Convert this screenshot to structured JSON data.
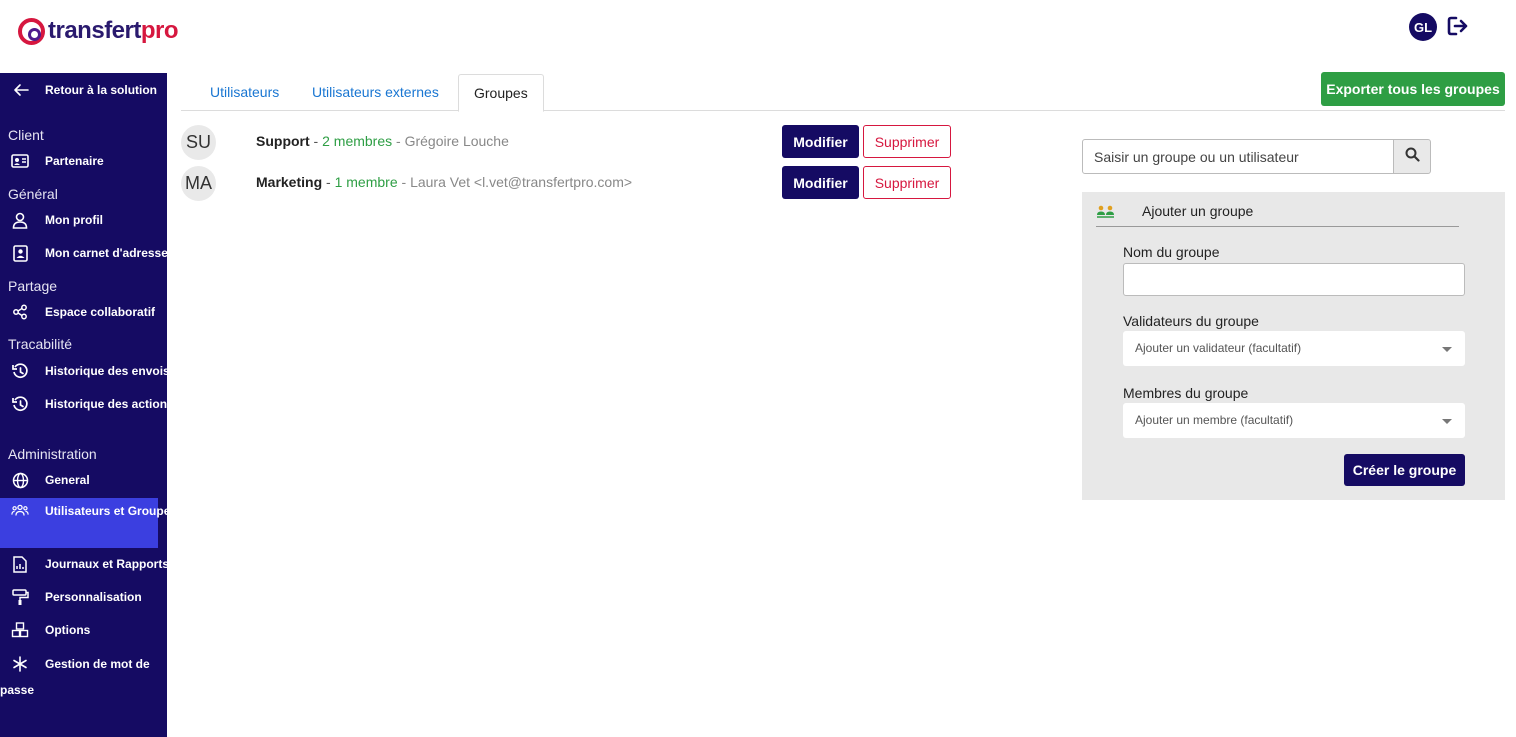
{
  "header": {
    "logo_main": "transfert",
    "logo_accent": "pro",
    "user_initials": "GL",
    "logout_icon": "logout-icon"
  },
  "sidebar": {
    "back_label": "Retour à la solution",
    "sections": {
      "client": "Client",
      "general": "Général",
      "partage": "Partage",
      "tracabilite": "Tracabilité",
      "administration": "Administration"
    },
    "items": {
      "partenaire": "Partenaire",
      "profil": "Mon profil",
      "carnet": "Mon carnet d'adresse",
      "espace": "Espace collaboratif",
      "hist_envois": "Historique des envois",
      "hist_actions": "Historique des actions",
      "general": "General",
      "utilisateurs": "Utilisateurs et Groupes",
      "journaux": "Journaux et Rapports",
      "personnalisation": "Personnalisation",
      "options": "Options",
      "mdp": "Gestion de mot de passe"
    }
  },
  "tabs": {
    "utilisateurs": "Utilisateurs",
    "externes": "Utilisateurs externes",
    "groupes": "Groupes",
    "active": "Groupes"
  },
  "export_label": "Exporter tous les groupes",
  "groups": [
    {
      "initials": "SU",
      "name": "Support",
      "count": "2 membres",
      "detail": "Grégoire Louche"
    },
    {
      "initials": "MA",
      "name": "Marketing",
      "count": "1 membre",
      "detail": "Laura Vet <l.vet@transfertpro.com>"
    }
  ],
  "group_actions": {
    "edit": "Modifier",
    "delete": "Supprimer",
    "separator": "-"
  },
  "search": {
    "placeholder": "Saisir un groupe ou un utilisateur"
  },
  "add_panel": {
    "title": "Ajouter un groupe",
    "name_label": "Nom du groupe",
    "name_value": "",
    "validators_label": "Validateurs du groupe",
    "validators_placeholder": "Ajouter un validateur (facultatif)",
    "members_label": "Membres du groupe",
    "members_placeholder": "Ajouter un membre (facultatif)",
    "create_label": "Créer le groupe"
  },
  "colors": {
    "navy": "#150b63",
    "active_item": "#3b3fe0",
    "green": "#2e9e44",
    "red": "#d6173f",
    "link_blue": "#1976d2"
  }
}
